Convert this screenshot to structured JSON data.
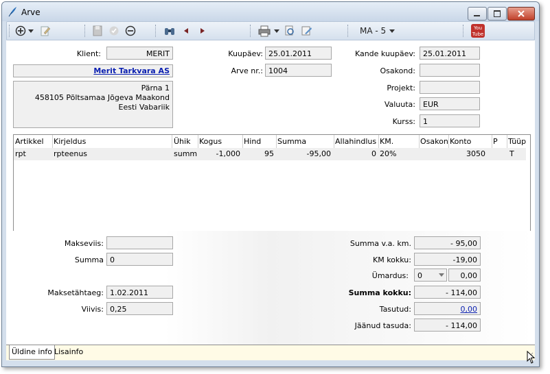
{
  "window": {
    "title": "Arve"
  },
  "toolbar": {
    "period": "MA - 5",
    "icons": [
      "add-icon",
      "edit-icon",
      "save-icon",
      "confirm-icon",
      "delete-icon",
      "binoculars-icon",
      "prev-icon",
      "next-icon",
      "print-icon",
      "preview-icon",
      "sign-icon",
      "youtube-icon"
    ],
    "youtube_top": "You",
    "youtube_bottom": "Tube"
  },
  "header": {
    "client_label": "Klient:",
    "client_value": "MERIT",
    "client_name": "Merit Tarkvara AS",
    "address_line1": "Pärna 1",
    "address_line2": "458105 Põltsamaa Jõgeva Maakond",
    "address_line3": "Eesti Vabariik",
    "date_label": "Kuupäev:",
    "date_value": "25.01.2011",
    "invoice_no_label": "Arve nr.:",
    "invoice_no_value": "1004",
    "entry_date_label": "Kande kuupäev:",
    "entry_date_value": "25.01.2011",
    "department_label": "Osakond:",
    "department_value": "",
    "project_label": "Projekt:",
    "project_value": "",
    "currency_label": "Valuuta:",
    "currency_value": "EUR",
    "rate_label": "Kurss:",
    "rate_value": "1"
  },
  "grid": {
    "columns": [
      "Artikkel",
      "Kirjeldus",
      "Ühik",
      "Kogus",
      "Hind",
      "Summa",
      "Allahindlus %",
      "KM.",
      "Osakond",
      "Konto",
      "P",
      "Tüüp"
    ],
    "rows": [
      [
        "rpt",
        "rpteenus",
        "summa",
        "-1,000",
        "95",
        "-95,00",
        "0",
        "20%",
        "",
        "3050",
        "",
        "T"
      ]
    ]
  },
  "payment": {
    "method_label": "Makseviis:",
    "method_value": "",
    "sum_label": "Summa",
    "sum_value": "0",
    "due_label": "Maksetähtaeg:",
    "due_value": "1.02.2011",
    "penalty_label": "Viivis:",
    "penalty_value": "0,25"
  },
  "totals": {
    "net_label": "Summa v.a. km.",
    "net_value": "- 95,00",
    "vat_label": "KM kokku:",
    "vat_value": "-19,00",
    "rounding_label": "Ümardus:",
    "rounding_mode": "0",
    "rounding_value": "0,00",
    "total_label": "Summa kokku:",
    "total_value": "- 114,00",
    "paid_label": "Tasutud:",
    "paid_value": "0,00",
    "remaining_label": "Jäänud tasuda:",
    "remaining_value": "- 114,00"
  },
  "tabs": [
    "Üldine info",
    "Lisainfo"
  ]
}
